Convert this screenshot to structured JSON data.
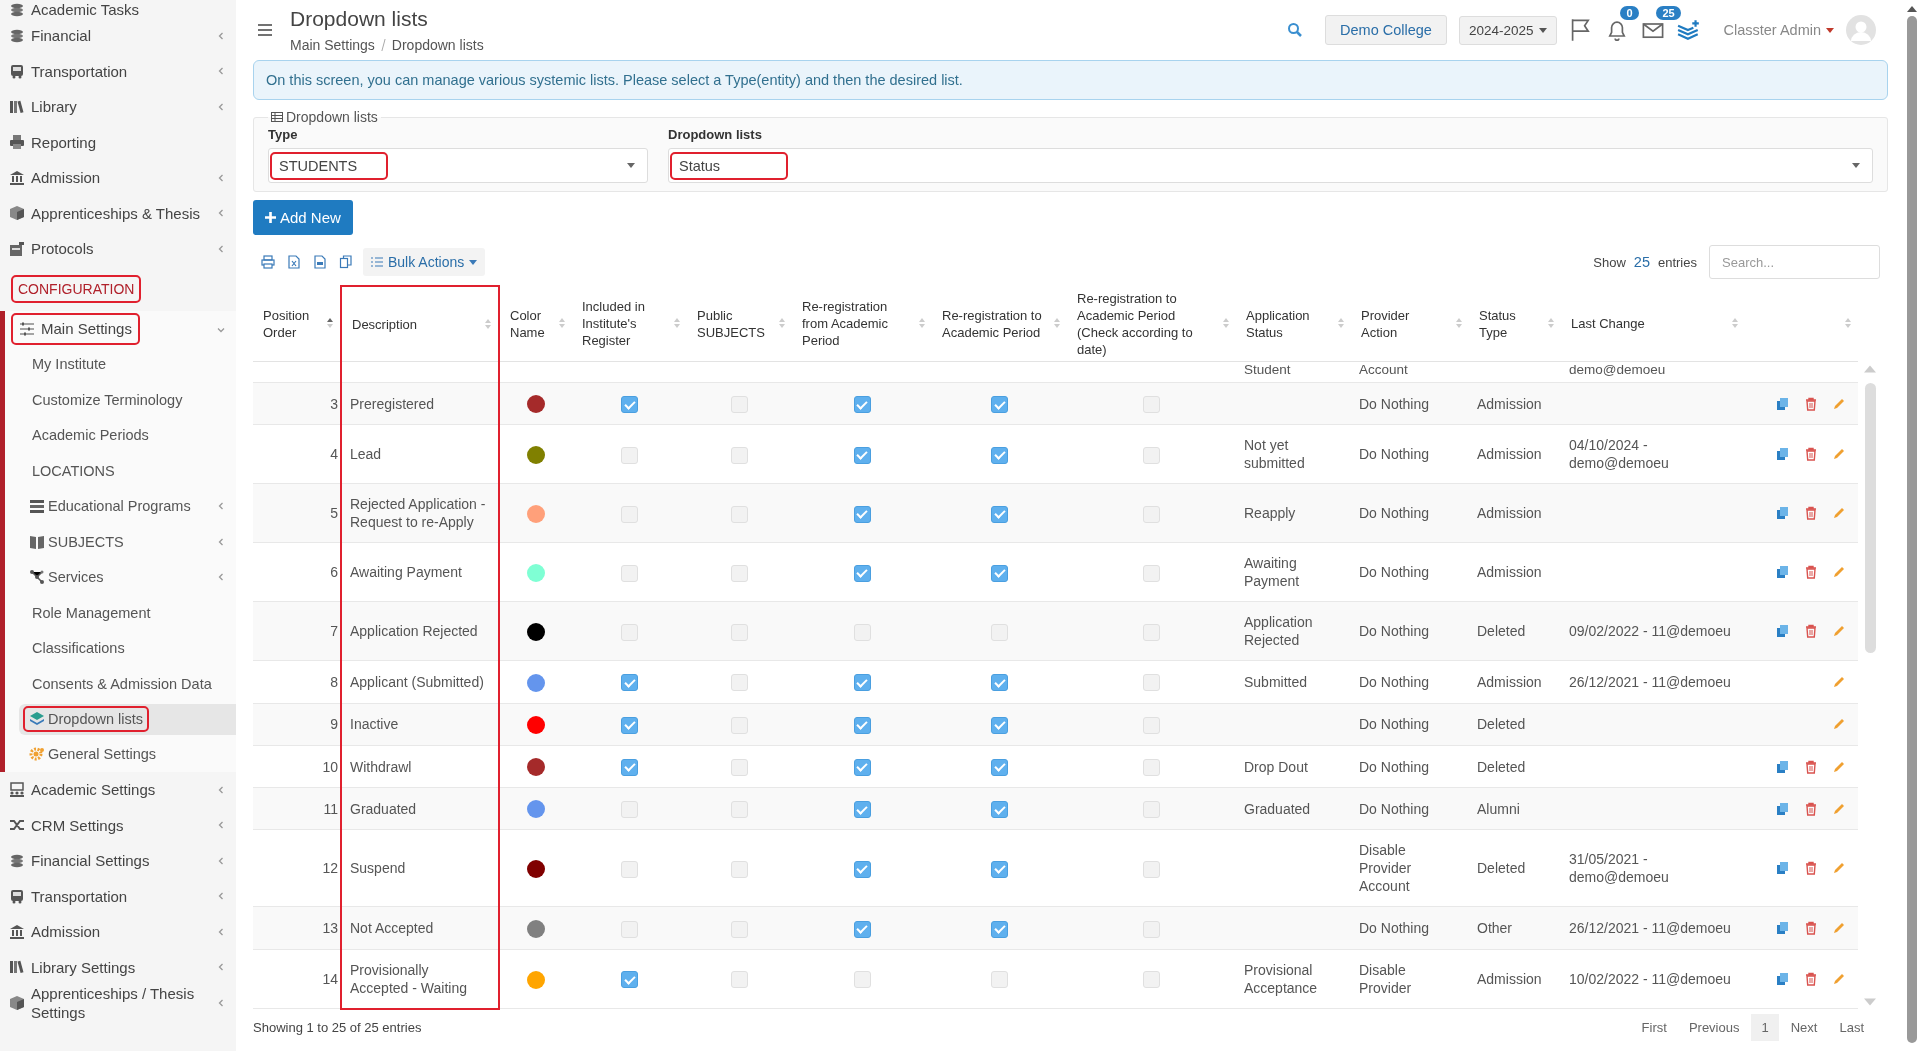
{
  "sidebar": {
    "items": [
      {
        "label": "Academic Tasks",
        "expandable": false
      },
      {
        "label": "Financial",
        "expandable": true
      },
      {
        "label": "Transportation",
        "expandable": true
      },
      {
        "label": "Library",
        "expandable": true
      },
      {
        "label": "Reporting",
        "expandable": false
      },
      {
        "label": "Admission",
        "expandable": true
      },
      {
        "label": "Apprenticeships & Thesis",
        "expandable": true
      },
      {
        "label": "Protocols",
        "expandable": true
      }
    ],
    "section": {
      "label": "CONFIGURATION",
      "highlighted": true
    },
    "group": {
      "label": "Main Settings",
      "expanded": true,
      "highlighted": true,
      "children": [
        {
          "label": "My Institute",
          "expandable": false,
          "selected": false,
          "highlighted": false
        },
        {
          "label": "Customize Terminology",
          "expandable": false,
          "selected": false,
          "highlighted": false
        },
        {
          "label": "Academic Periods",
          "expandable": false,
          "selected": false,
          "highlighted": false
        },
        {
          "label": "LOCATIONS",
          "expandable": false,
          "selected": false,
          "highlighted": false
        },
        {
          "label": "Educational Programs",
          "expandable": true,
          "selected": false,
          "highlighted": false
        },
        {
          "label": "SUBJECTS",
          "expandable": true,
          "selected": false,
          "highlighted": false
        },
        {
          "label": "Services",
          "expandable": true,
          "selected": false,
          "highlighted": false
        },
        {
          "label": "Role Management",
          "expandable": false,
          "selected": false,
          "highlighted": false
        },
        {
          "label": "Classifications",
          "expandable": false,
          "selected": false,
          "highlighted": false
        },
        {
          "label": "Consents & Admission Data",
          "expandable": false,
          "selected": false,
          "highlighted": false
        },
        {
          "label": "Dropdown lists",
          "expandable": false,
          "selected": true,
          "highlighted": true
        },
        {
          "label": "General Settings",
          "expandable": false,
          "selected": false,
          "highlighted": false
        }
      ]
    },
    "bottom_items": [
      {
        "label": "Academic Settings",
        "expandable": true
      },
      {
        "label": "CRM Settings",
        "expandable": true
      },
      {
        "label": "Financial Settings",
        "expandable": true
      },
      {
        "label": "Transportation",
        "expandable": true
      },
      {
        "label": "Admission",
        "expandable": true
      },
      {
        "label": "Library Settings",
        "expandable": true
      },
      {
        "label": "Apprenticeships / Thesis Settings",
        "expandable": true
      }
    ]
  },
  "header": {
    "title": "Dropdown lists",
    "breadcrumb": [
      "Main Settings",
      "Dropdown lists"
    ],
    "institution": "Demo College",
    "year": "2024-2025",
    "notifications": "0",
    "messages": "25",
    "user": "Classter Admin"
  },
  "info": "On this screen, you can manage various systemic lists. Please select a Type(entity) and then the desired list.",
  "filter": {
    "legend": "Dropdown lists",
    "type": {
      "label": "Type",
      "value": "STUDENTS",
      "highlighted": true
    },
    "list": {
      "label": "Dropdown lists",
      "value": "Status",
      "highlighted": true
    }
  },
  "add_button": "Add New",
  "toolbar": {
    "bulk": "Bulk Actions",
    "show": "Show",
    "page_size": "25",
    "entries": "entries",
    "search_placeholder": "Search..."
  },
  "table": {
    "columns": [
      {
        "label": "Position Order",
        "sorted": true,
        "highlighted": false
      },
      {
        "label": "Description",
        "sorted": false,
        "highlighted": true
      },
      {
        "label": "Color Name",
        "sorted": false,
        "highlighted": false
      },
      {
        "label": "Included in Institute's Register",
        "sorted": false,
        "highlighted": false
      },
      {
        "label": "Public SUBJECTS",
        "sorted": false,
        "highlighted": false
      },
      {
        "label": "Re-registration from Academic Period",
        "sorted": false,
        "highlighted": false
      },
      {
        "label": "Re-registration to Academic Period",
        "sorted": false,
        "highlighted": false
      },
      {
        "label": "Re-registration to Academic Period (Check according to date)",
        "sorted": false,
        "highlighted": false
      },
      {
        "label": "Application Status",
        "sorted": false,
        "highlighted": false
      },
      {
        "label": "Provider Action",
        "sorted": false,
        "highlighted": false
      },
      {
        "label": "Status Type",
        "sorted": false,
        "highlighted": false
      },
      {
        "label": "Last Change",
        "sorted": false,
        "highlighted": false
      },
      {
        "sorted": false,
        "highlighted": false
      }
    ],
    "rows": [
      {
        "application_status": "Student",
        "provider_action": "Account",
        "last_change": "demo@demoeu"
      },
      {
        "order": "3",
        "description": "Preregistered",
        "color": "#a52a2a",
        "included": true,
        "public": false,
        "from_period": true,
        "to_period": true,
        "check_date": false,
        "provider_action": "Do Nothing",
        "status_type": "Admission",
        "copy": true,
        "delete": true,
        "edit": true
      },
      {
        "order": "4",
        "description": "Lead",
        "color": "#808000",
        "included": false,
        "public": false,
        "from_period": true,
        "to_period": true,
        "check_date": false,
        "application_status": "Not yet submitted",
        "provider_action": "Do Nothing",
        "status_type": "Admission",
        "last_change": "04/10/2024 - demo@demoeu",
        "copy": true,
        "delete": true,
        "edit": true
      },
      {
        "order": "5",
        "description": "Rejected Application - Request to re-Apply",
        "color": "#ffa07a",
        "included": false,
        "public": false,
        "from_period": true,
        "to_period": true,
        "check_date": false,
        "application_status": "Reapply",
        "provider_action": "Do Nothing",
        "status_type": "Admission",
        "copy": true,
        "delete": true,
        "edit": true
      },
      {
        "order": "6",
        "description": "Awaiting Payment",
        "color": "#7fffd4",
        "included": false,
        "public": false,
        "from_period": true,
        "to_period": true,
        "check_date": false,
        "application_status": "Awaiting Payment",
        "provider_action": "Do Nothing",
        "status_type": "Admission",
        "copy": true,
        "delete": true,
        "edit": true
      },
      {
        "order": "7",
        "description": "Application Rejected",
        "color": "#000000",
        "included": false,
        "public": false,
        "from_period": false,
        "to_period": false,
        "check_date": false,
        "application_status": "Application Rejected",
        "provider_action": "Do Nothing",
        "status_type": "Deleted",
        "last_change": "09/02/2022 - 11@demoeu",
        "copy": true,
        "delete": true,
        "edit": true
      },
      {
        "order": "8",
        "description": "Applicant (Submitted)",
        "color": "#6495ed",
        "included": true,
        "public": false,
        "from_period": true,
        "to_period": true,
        "check_date": false,
        "application_status": "Submitted",
        "provider_action": "Do Nothing",
        "status_type": "Admission",
        "last_change": "26/12/2021 - 11@demoeu",
        "copy": false,
        "delete": false,
        "edit": true
      },
      {
        "order": "9",
        "description": "Inactive",
        "color": "#ff0000",
        "included": true,
        "public": false,
        "from_period": true,
        "to_period": true,
        "check_date": false,
        "provider_action": "Do Nothing",
        "status_type": "Deleted",
        "copy": false,
        "delete": false,
        "edit": true
      },
      {
        "order": "10",
        "description": "Withdrawl",
        "color": "#a52a2a",
        "included": true,
        "public": false,
        "from_period": true,
        "to_period": true,
        "check_date": false,
        "application_status": "Drop Dout",
        "provider_action": "Do Nothing",
        "status_type": "Deleted",
        "copy": true,
        "delete": true,
        "edit": true
      },
      {
        "order": "11",
        "description": "Graduated",
        "color": "#6495ed",
        "included": false,
        "public": false,
        "from_period": true,
        "to_period": true,
        "check_date": false,
        "application_status": "Graduated",
        "provider_action": "Do Nothing",
        "status_type": "Alumni",
        "copy": true,
        "delete": true,
        "edit": true
      },
      {
        "order": "12",
        "description": "Suspend",
        "color": "#800000",
        "included": false,
        "public": false,
        "from_period": true,
        "to_period": true,
        "check_date": false,
        "provider_action": "Disable Provider Account",
        "status_type": "Deleted",
        "last_change": "31/05/2021 - demo@demoeu",
        "copy": true,
        "delete": true,
        "edit": true
      },
      {
        "order": "13",
        "description": "Not Accepted",
        "color": "#808080",
        "included": false,
        "public": false,
        "from_period": true,
        "to_period": true,
        "check_date": false,
        "provider_action": "Do Nothing",
        "status_type": "Other",
        "last_change": "26/12/2021 - 11@demoeu",
        "copy": true,
        "delete": true,
        "edit": true
      },
      {
        "order": "14",
        "description": "Provisionally Accepted - Waiting",
        "color": "#ffa500",
        "included": true,
        "public": false,
        "from_period": false,
        "to_period": false,
        "check_date": false,
        "application_status": "Provisional Acceptance",
        "provider_action": "Disable Provider",
        "status_type": "Admission",
        "last_change": "10/02/2022 - 11@demoeu",
        "copy": true,
        "delete": true,
        "edit": true
      }
    ]
  },
  "footer": {
    "info": "Showing 1 to 25 of 25 entries",
    "pages": [
      {
        "label": "First",
        "selected": false
      },
      {
        "label": "Previous",
        "selected": false
      },
      {
        "label": "1",
        "selected": true
      },
      {
        "label": "Next",
        "selected": false
      },
      {
        "label": "Last",
        "selected": false
      }
    ]
  }
}
